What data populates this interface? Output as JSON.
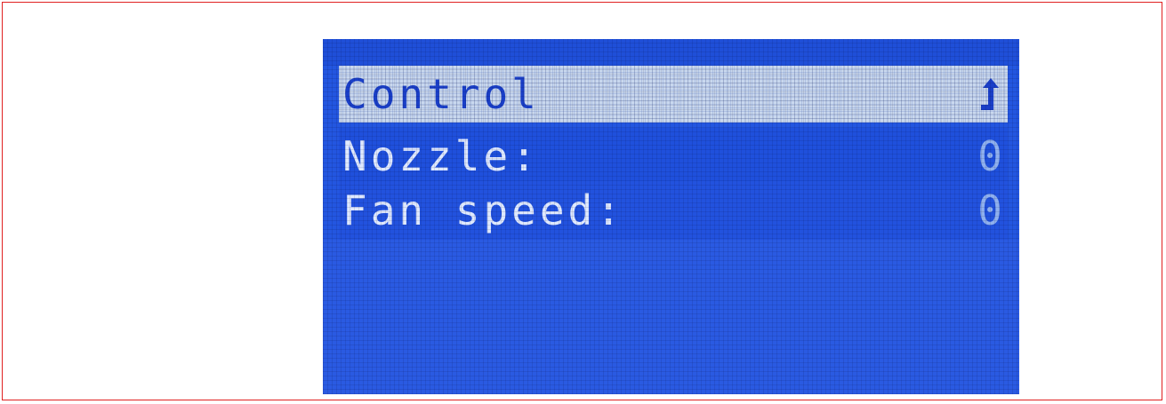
{
  "menu": {
    "items": [
      {
        "label": "Control",
        "icon": "back-arrow-icon",
        "selected": true
      },
      {
        "label": "Nozzle:",
        "value": "0"
      },
      {
        "label": "Fan speed:",
        "value": "0"
      }
    ]
  },
  "colors": {
    "lcd_background": "#2356e0",
    "selected_row": "#c9d8ee",
    "selected_text": "#1a3fc8",
    "text": "#dfe9ff",
    "frame_border": "#e02020"
  }
}
